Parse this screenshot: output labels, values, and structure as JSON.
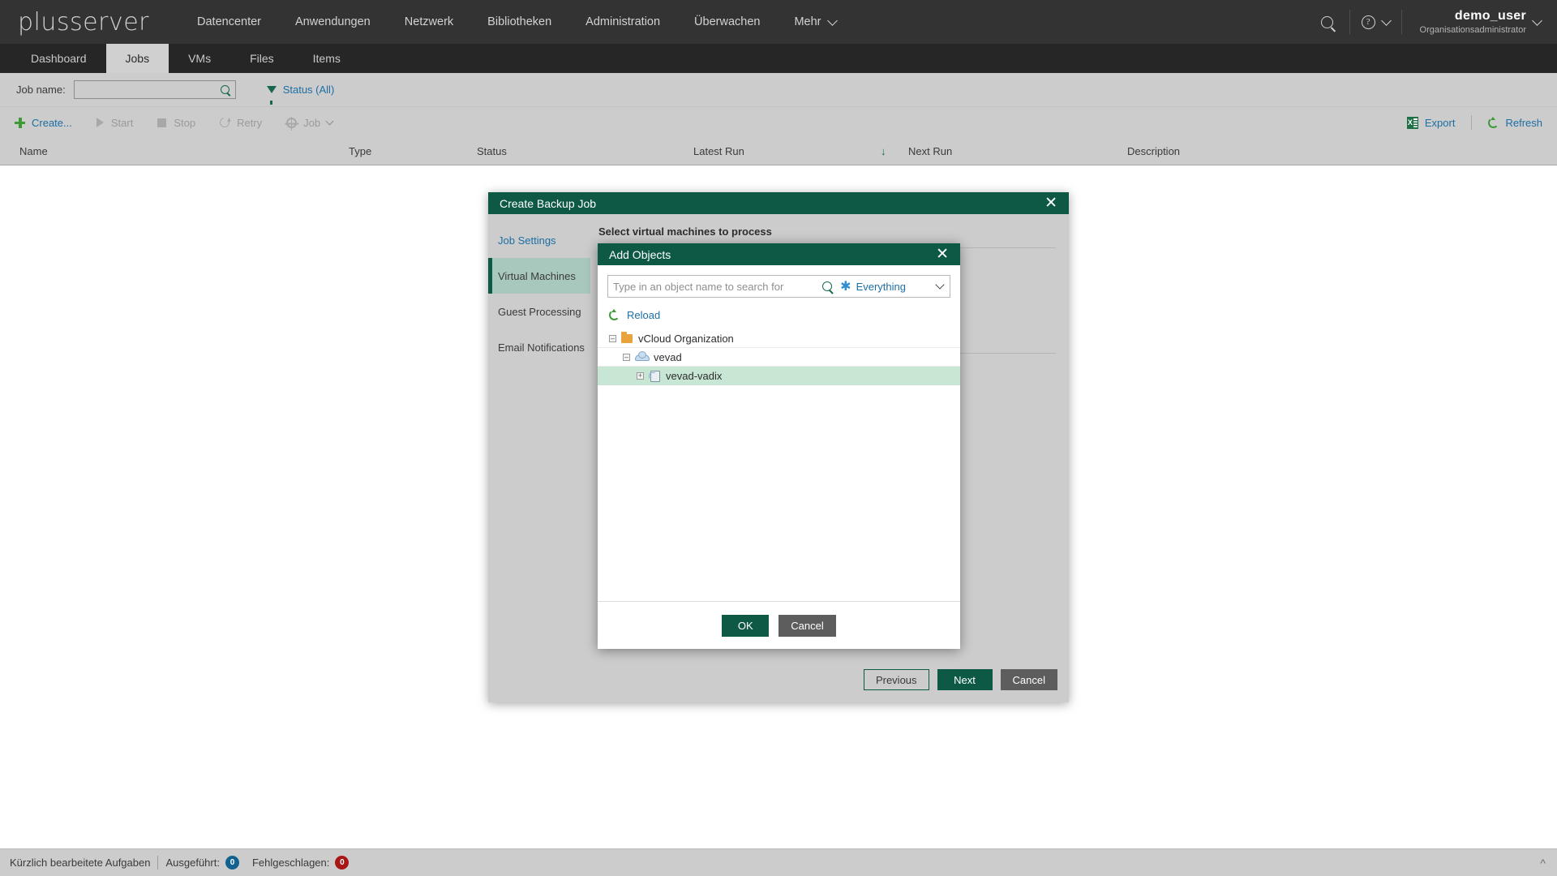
{
  "header": {
    "brand": "plusserver",
    "nav_items": [
      {
        "label": "Datencenter"
      },
      {
        "label": "Anwendungen"
      },
      {
        "label": "Netzwerk"
      },
      {
        "label": "Bibliotheken"
      },
      {
        "label": "Administration"
      },
      {
        "label": "Überwachen"
      },
      {
        "label": "Mehr"
      }
    ],
    "user_name": "demo_user",
    "user_role": "Organisationsadministrator"
  },
  "tabs": [
    {
      "label": "Dashboard",
      "active": false
    },
    {
      "label": "Jobs",
      "active": true
    },
    {
      "label": "VMs",
      "active": false
    },
    {
      "label": "Files",
      "active": false
    },
    {
      "label": "Items",
      "active": false
    }
  ],
  "filter": {
    "job_name_label": "Job name:",
    "job_name_value": "",
    "job_name_placeholder": "",
    "status_label": "Status (All)"
  },
  "toolbar": {
    "create": "Create...",
    "start": "Start",
    "stop": "Stop",
    "retry": "Retry",
    "job": "Job",
    "export": "Export",
    "refresh": "Refresh"
  },
  "table": {
    "columns": [
      "Name",
      "Type",
      "Status",
      "Latest Run",
      "Next Run",
      "Description"
    ],
    "rows": []
  },
  "statusbar": {
    "recent_tasks": "Kürzlich bearbeitete Aufgaben",
    "executed_label": "Ausgeführt:",
    "executed_count": "0",
    "failed_label": "Fehlgeschlagen:",
    "failed_count": "0"
  },
  "wizard": {
    "title": "Create Backup Job",
    "steps": [
      {
        "label": "Job Settings",
        "active": false
      },
      {
        "label": "Virtual Machines",
        "active": true
      },
      {
        "label": "Guest Processing",
        "active": false
      },
      {
        "label": "Email Notifications",
        "active": false
      }
    ],
    "heading": "Select virtual machines to process",
    "buttons": {
      "previous": "Previous",
      "next": "Next",
      "cancel": "Cancel"
    }
  },
  "add_objects": {
    "title": "Add Objects",
    "search_placeholder": "Type in an object name to search for",
    "search_value": "",
    "scope": "Everything",
    "reload": "Reload",
    "tree": [
      {
        "label": "vCloud Organization",
        "level": 0,
        "icon": "folder-icon",
        "expander": "–",
        "selected": false
      },
      {
        "label": "vevad",
        "level": 1,
        "icon": "cloud-icon",
        "expander": "–",
        "selected": false
      },
      {
        "label": "vevad-vadix",
        "level": 2,
        "icon": "vapp-icon",
        "expander": "+",
        "selected": true
      }
    ],
    "buttons": {
      "ok": "OK",
      "cancel": "Cancel"
    }
  },
  "colors": {
    "brand_green": "#0d5946",
    "accent_blue": "#1c6ea4",
    "icon_green": "#3d9b35",
    "selection_green": "#c8e6d4"
  }
}
